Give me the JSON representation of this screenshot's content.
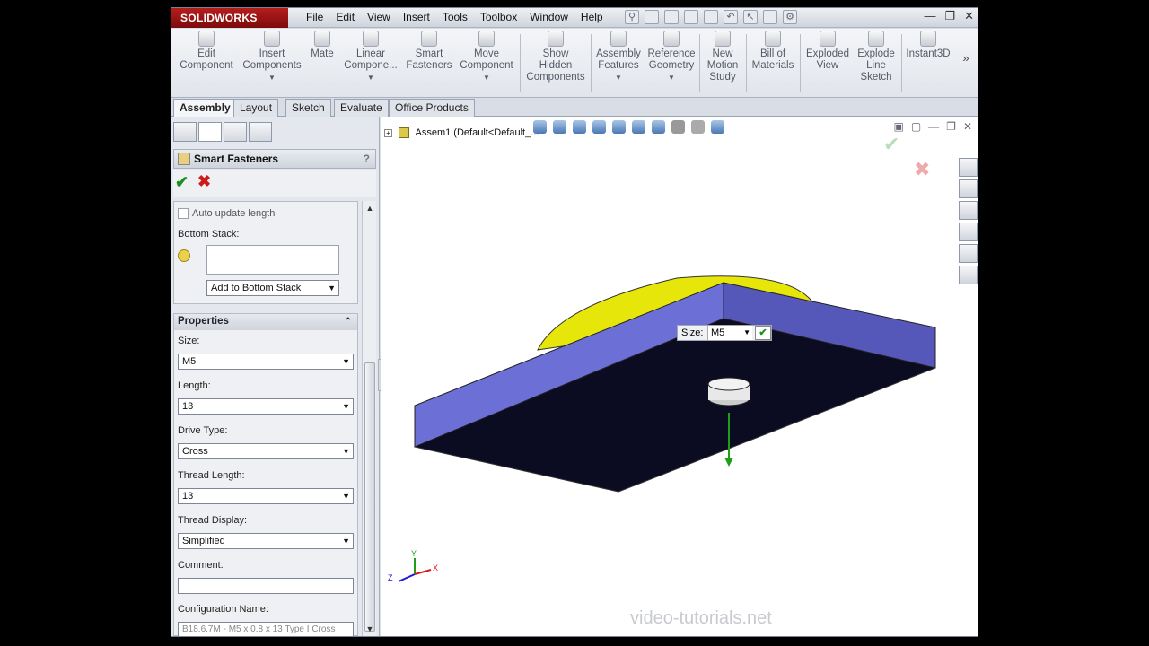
{
  "app": {
    "logo": "SOLIDWORKS"
  },
  "menu": [
    "File",
    "Edit",
    "View",
    "Insert",
    "Tools",
    "Toolbox",
    "Window",
    "Help"
  ],
  "commands": [
    {
      "l1": "Edit",
      "l2": "Component",
      "l3": ""
    },
    {
      "l1": "Insert",
      "l2": "Components",
      "l3": ""
    },
    {
      "l1": "Mate",
      "l2": "",
      "l3": ""
    },
    {
      "l1": "Linear",
      "l2": "Compone...",
      "l3": ""
    },
    {
      "l1": "Smart",
      "l2": "Fasteners",
      "l3": ""
    },
    {
      "l1": "Move",
      "l2": "Component",
      "l3": ""
    },
    {
      "l1": "Show",
      "l2": "Hidden",
      "l3": "Components"
    },
    {
      "l1": "Assembly",
      "l2": "Features",
      "l3": ""
    },
    {
      "l1": "Reference",
      "l2": "Geometry",
      "l3": ""
    },
    {
      "l1": "New",
      "l2": "Motion",
      "l3": "Study"
    },
    {
      "l1": "Bill of",
      "l2": "Materials",
      "l3": ""
    },
    {
      "l1": "Exploded",
      "l2": "View",
      "l3": ""
    },
    {
      "l1": "Explode",
      "l2": "Line",
      "l3": "Sketch"
    },
    {
      "l1": "Instant3D",
      "l2": "",
      "l3": ""
    }
  ],
  "tabs": [
    "Assembly",
    "Layout",
    "Sketch",
    "Evaluate",
    "Office Products"
  ],
  "pm": {
    "title": "Smart Fasteners",
    "help": "?",
    "auto_update": "Auto update length",
    "bottom_stack": "Bottom Stack:",
    "add_bottom": "Add to Bottom Stack",
    "properties": "Properties",
    "size_label": "Size:",
    "size_value": "M5",
    "length_label": "Length:",
    "length_value": "13",
    "drive_label": "Drive Type:",
    "drive_value": "Cross",
    "thread_len_label": "Thread Length:",
    "thread_len_value": "13",
    "thread_disp_label": "Thread Display:",
    "thread_disp_value": "Simplified",
    "comment_label": "Comment:",
    "comment_value": "",
    "config_label": "Configuration Name:",
    "config_value": "B18.6.7M - M5 x 0.8 x 13 Type I Cross"
  },
  "tree": {
    "root": "Assem1  (Default<Default_..."
  },
  "popup": {
    "label": "Size:",
    "value": "M5"
  },
  "triad": {
    "x": "X",
    "y": "Y",
    "z": "Z"
  },
  "watermark": "video-tutorials.net",
  "colors": {
    "plate_top": "#6b6fd6",
    "plate_side": "#0b0b22",
    "yellow": "#e6e60a",
    "accent": "#cf1a1a",
    "ok": "#1e8f1e"
  }
}
